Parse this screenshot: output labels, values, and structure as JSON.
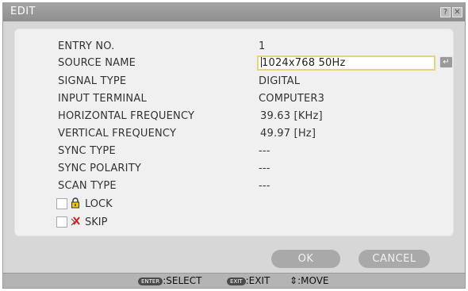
{
  "window": {
    "title": "EDIT",
    "help_label": "?",
    "close_label": "✕"
  },
  "fields": {
    "entry_no": {
      "label": "ENTRY NO.",
      "value": "1"
    },
    "source_name": {
      "label": "SOURCE NAME",
      "value": "1024x768 50Hz"
    },
    "signal_type": {
      "label": "SIGNAL TYPE",
      "value": "DIGITAL"
    },
    "input_terminal": {
      "label": "INPUT TERMINAL",
      "value": "COMPUTER3"
    },
    "horizontal_frequency": {
      "label": "HORIZONTAL FREQUENCY",
      "value": "39.63 [KHz]"
    },
    "vertical_frequency": {
      "label": "VERTICAL FREQUENCY",
      "value": "49.97 [Hz]"
    },
    "sync_type": {
      "label": "SYNC TYPE",
      "value": "---"
    },
    "sync_polarity": {
      "label": "SYNC POLARITY",
      "value": "---"
    },
    "scan_type": {
      "label": "SCAN TYPE",
      "value": "---"
    }
  },
  "options": {
    "lock": {
      "label": "LOCK",
      "checked": false,
      "icon": "lock-icon"
    },
    "skip": {
      "label": "SKIP",
      "checked": false,
      "icon": "skip-icon"
    }
  },
  "buttons": {
    "ok_label": "OK",
    "cancel_label": "CANCEL",
    "enter_glyph": "↵"
  },
  "statusbar": {
    "select_key": "ENTER",
    "select_label": ":SELECT",
    "exit_key": "EXIT",
    "exit_label": ":EXIT",
    "move_glyph": "⇕",
    "move_label": ":MOVE"
  },
  "colors": {
    "title_bar": "#999999",
    "panel": "#f0f0f0",
    "input_border": "#e7d37c",
    "button": "#a9a9a9"
  }
}
